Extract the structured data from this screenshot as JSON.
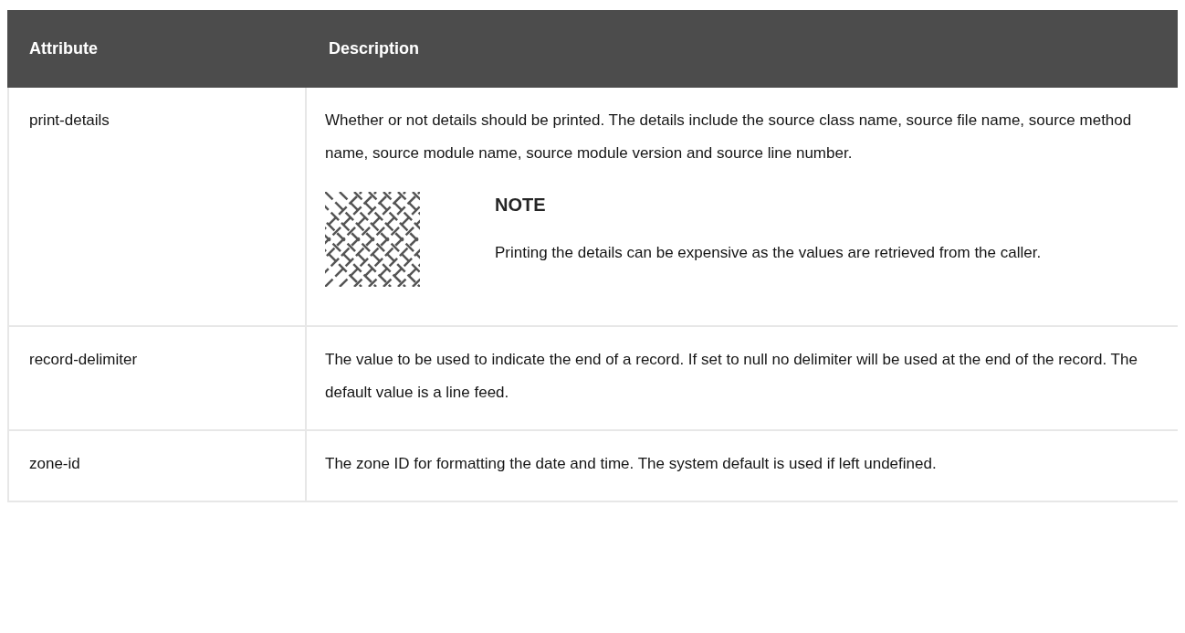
{
  "table": {
    "columns": [
      "Attribute",
      "Description"
    ],
    "rows": [
      {
        "attribute": "print-details",
        "description": "Whether or not details should be printed. The details include the source class name, source file name, source method name, source module name, source module version and source line number.",
        "note": {
          "title": "NOTE",
          "text": "Printing the details can be expensive as the values are retrieved from the caller."
        }
      },
      {
        "attribute": "record-delimiter",
        "description": "The value to be used to indicate the end of a record. If set to null no delimiter will be used at the end of the record. The default value is a line feed."
      },
      {
        "attribute": "zone-id",
        "description": "The zone ID for formatting the date and time. The system default is used if left undefined."
      }
    ]
  }
}
